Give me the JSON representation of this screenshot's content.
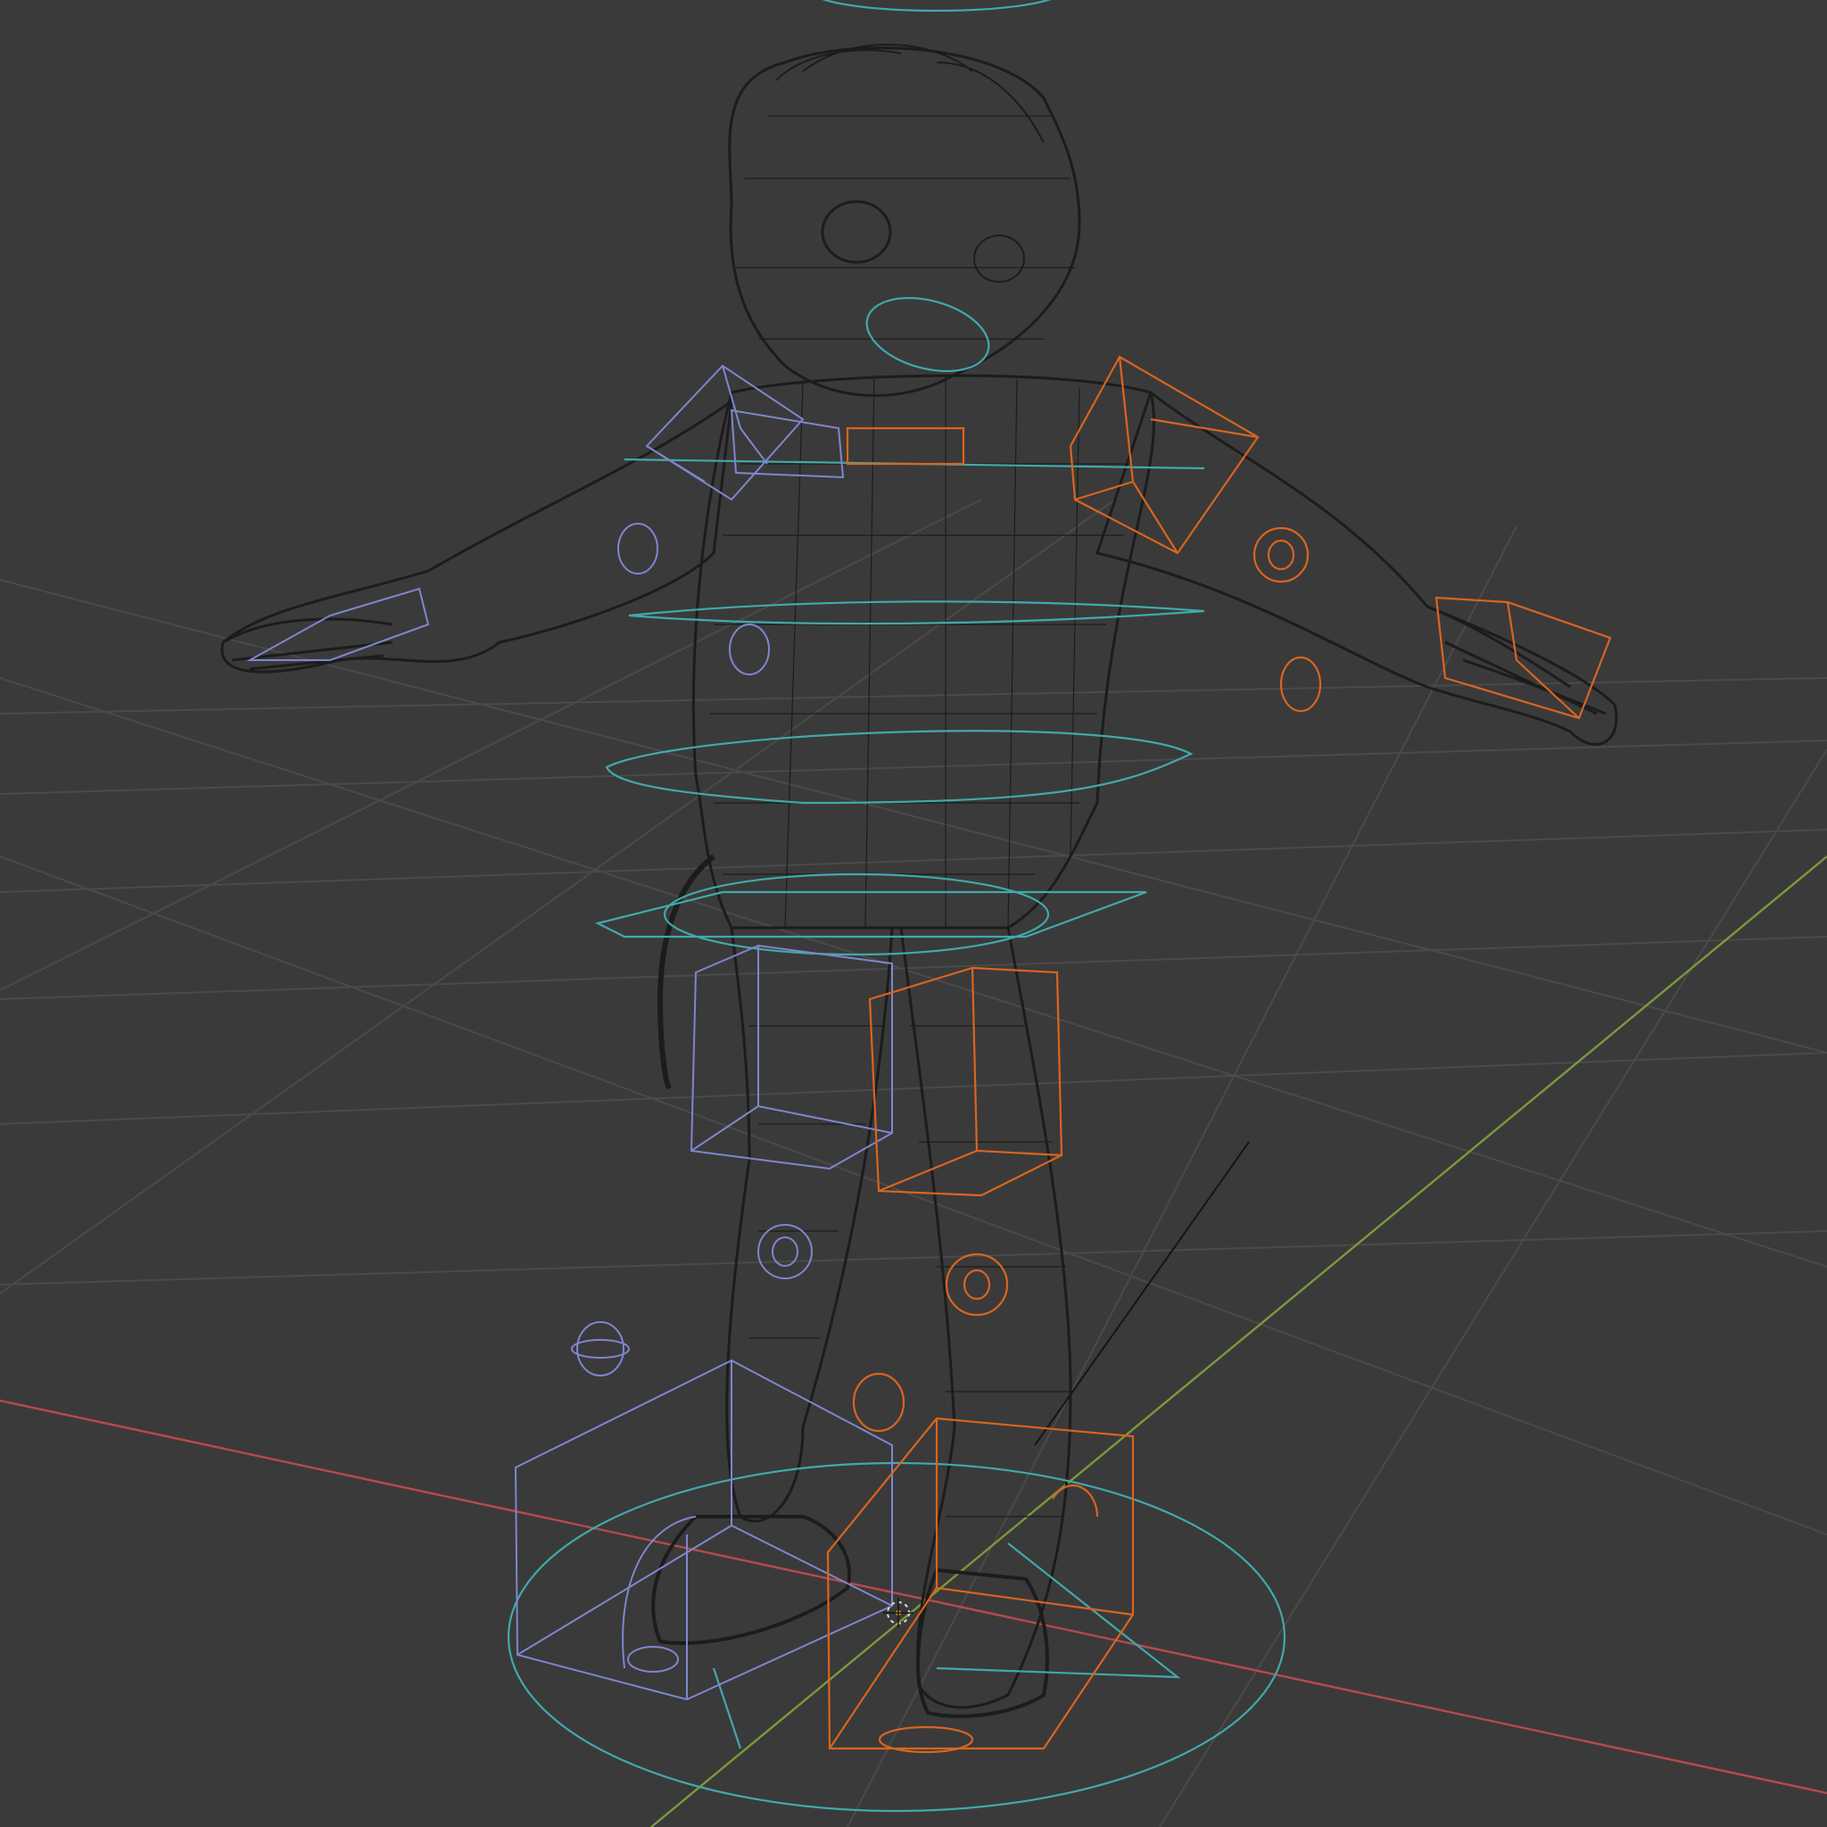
{
  "viewport": {
    "editor": "3D Viewport",
    "shading": "wireframe",
    "background": "#3a3a3a",
    "grid_color": "#4a4a4a",
    "mesh_wire_color": "#1c1c1c"
  },
  "axes": {
    "x_color": "#b84a4a",
    "y_color": "#7b9a3a"
  },
  "rig": {
    "controller_colors": {
      "center": "#41a9ad",
      "left": "#7f86cf",
      "right": "#d8651f"
    }
  },
  "icons": {
    "cursor": "3d-cursor-icon",
    "origin": "origin-dot-icon"
  }
}
